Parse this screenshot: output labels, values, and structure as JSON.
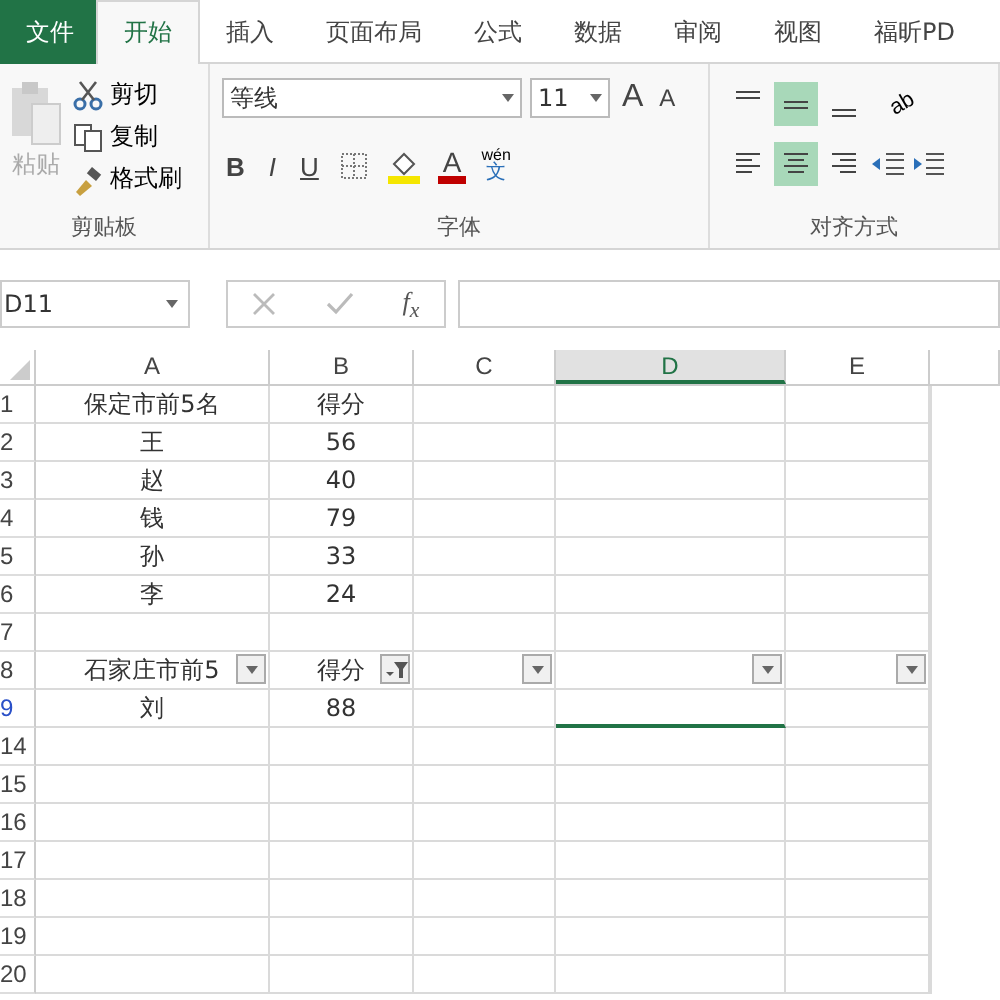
{
  "ribbon_tabs": [
    {
      "label": "文件",
      "kind": "file",
      "selected": false
    },
    {
      "label": "开始",
      "kind": "tab",
      "selected": true
    },
    {
      "label": "插入",
      "kind": "tab",
      "selected": false
    },
    {
      "label": "页面布局",
      "kind": "tab",
      "selected": false
    },
    {
      "label": "公式",
      "kind": "tab",
      "selected": false
    },
    {
      "label": "数据",
      "kind": "tab",
      "selected": false
    },
    {
      "label": "审阅",
      "kind": "tab",
      "selected": false
    },
    {
      "label": "视图",
      "kind": "tab",
      "selected": false
    },
    {
      "label": "福昕PD",
      "kind": "tab",
      "selected": false
    }
  ],
  "clipboard": {
    "paste": {
      "label": "粘贴",
      "disabled": true
    },
    "items": [
      {
        "label": "剪切",
        "kind": "cut"
      },
      {
        "label": "复制",
        "kind": "copy"
      },
      {
        "label": "格式刷",
        "kind": "brush"
      }
    ],
    "group_label": "剪贴板"
  },
  "font": {
    "font_name": "等线",
    "font_size": "11",
    "grow": "A",
    "shrink": "A",
    "bold": "B",
    "italic": "I",
    "underline": "U",
    "font_color": "A",
    "phonetic_top": "wén",
    "phonetic_bottom": "文",
    "group_label": "字体"
  },
  "alignment": {
    "top_row": [
      {
        "kind": "top",
        "selected": false
      },
      {
        "kind": "middle",
        "selected": true
      },
      {
        "kind": "bottom",
        "selected": false
      }
    ],
    "bottom_row": [
      {
        "kind": "left",
        "selected": false
      },
      {
        "kind": "center",
        "selected": true
      },
      {
        "kind": "right",
        "selected": false
      }
    ],
    "orientation": "ab",
    "group_label": "对齐方式"
  },
  "formula_bar": {
    "name_box": "D11",
    "fx": "f$_{x}$"
  },
  "columns": [
    {
      "label": "A",
      "selected": false
    },
    {
      "label": "B",
      "selected": false
    },
    {
      "label": "C",
      "selected": false
    },
    {
      "label": "D",
      "selected": true
    },
    {
      "label": "E",
      "selected": false
    }
  ],
  "rows": [
    {
      "number": "1",
      "filtered": false,
      "cells": [
        "保定市前5名",
        "得分",
        "",
        "",
        ""
      ]
    },
    {
      "number": "2",
      "filtered": false,
      "cells": [
        "王",
        "56",
        "",
        "",
        ""
      ]
    },
    {
      "number": "3",
      "filtered": false,
      "cells": [
        "赵",
        "40",
        "",
        "",
        ""
      ]
    },
    {
      "number": "4",
      "filtered": false,
      "cells": [
        "钱",
        "79",
        "",
        "",
        ""
      ]
    },
    {
      "number": "5",
      "filtered": false,
      "cells": [
        "孙",
        "33",
        "",
        "",
        ""
      ]
    },
    {
      "number": "6",
      "filtered": false,
      "cells": [
        "李",
        "24",
        "",
        "",
        ""
      ]
    },
    {
      "number": "7",
      "filtered": false,
      "cells": [
        "",
        "",
        "",
        "",
        ""
      ]
    },
    {
      "number": "8",
      "filtered": false,
      "cells": [
        "石家庄市前5",
        "得分",
        "",
        "",
        ""
      ],
      "filter_buttons": [
        {
          "active": false
        },
        {
          "active": true
        },
        {
          "active": false
        },
        {
          "active": false
        },
        {
          "active": false
        }
      ]
    },
    {
      "number": "9",
      "filtered": true,
      "selection_edge": true,
      "cells": [
        "刘",
        "88",
        "",
        "",
        ""
      ]
    },
    {
      "number": "14",
      "filtered": false,
      "cells": [
        "",
        "",
        "",
        "",
        ""
      ]
    },
    {
      "number": "15",
      "filtered": false,
      "cells": [
        "",
        "",
        "",
        "",
        ""
      ]
    },
    {
      "number": "16",
      "filtered": false,
      "cells": [
        "",
        "",
        "",
        "",
        ""
      ]
    },
    {
      "number": "17",
      "filtered": false,
      "cells": [
        "",
        "",
        "",
        "",
        ""
      ]
    },
    {
      "number": "18",
      "filtered": false,
      "cells": [
        "",
        "",
        "",
        "",
        ""
      ]
    },
    {
      "number": "19",
      "filtered": false,
      "cells": [
        "",
        "",
        "",
        "",
        ""
      ]
    },
    {
      "number": "20",
      "filtered": false,
      "cells": [
        "",
        "",
        "",
        "",
        ""
      ]
    }
  ]
}
